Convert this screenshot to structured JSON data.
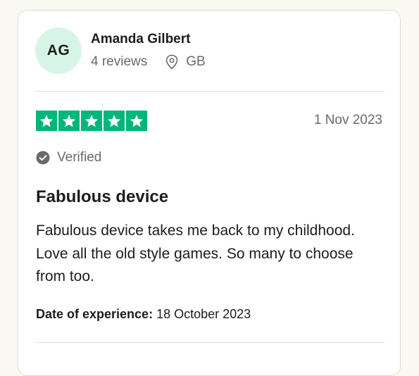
{
  "reviewer": {
    "initials": "AG",
    "name": "Amanda Gilbert",
    "review_count": "4 reviews",
    "location_icon": "location-pin-icon",
    "country": "GB"
  },
  "review": {
    "rating": 5,
    "max_rating": 5,
    "star_color": "#00b67a",
    "date": "1 Nov 2023",
    "verified_icon": "check-circle-icon",
    "verified_label": "Verified",
    "title": "Fabulous device",
    "body": "Fabulous device takes me back to my childhood. Love all the old style games. So many to choose from too.",
    "experience_label": "Date of experience:",
    "experience_date": "18 October 2023"
  },
  "colors": {
    "avatar_bg": "#d6f5e6",
    "page_bg": "#f9f9f2",
    "muted_text": "#696a6a"
  }
}
